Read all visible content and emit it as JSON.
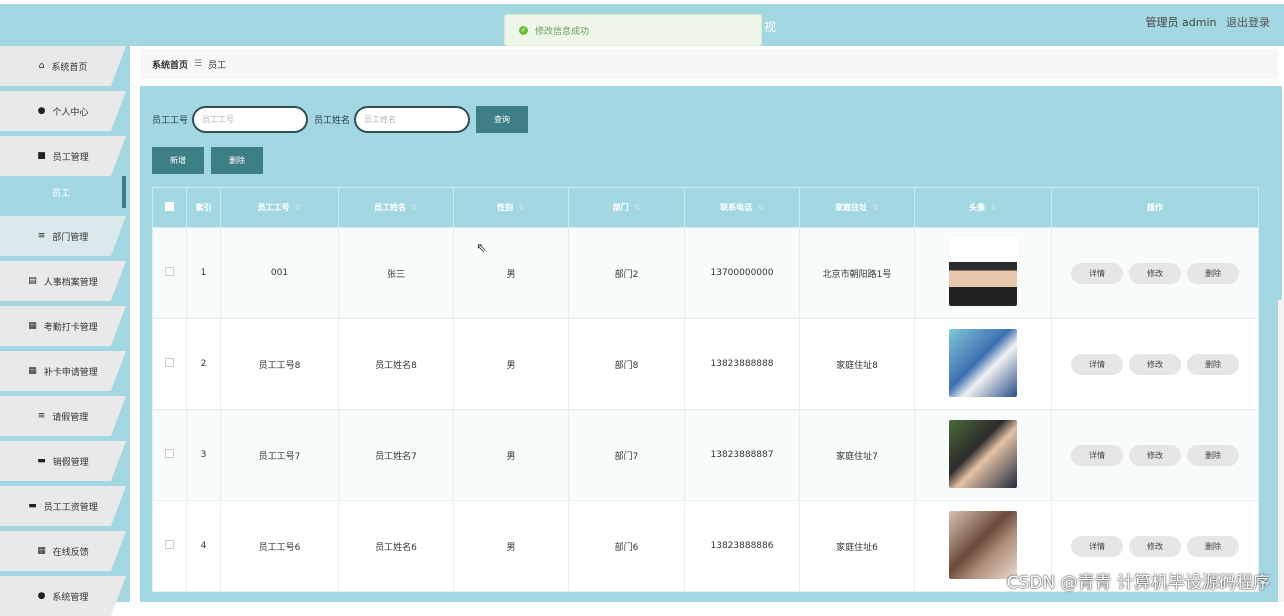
{
  "header": {
    "user_label": "管理员 admin",
    "logout_label": "退出登录",
    "glyph": "视"
  },
  "toast": {
    "message": "修改信息成功"
  },
  "sidebar": {
    "items": [
      {
        "label": "系统首页",
        "icon": "home-icon",
        "glyph": "⌂"
      },
      {
        "label": "个人中心",
        "icon": "user-icon",
        "glyph": "●"
      },
      {
        "label": "员工管理",
        "icon": "briefcase-icon",
        "glyph": "■"
      },
      {
        "label": "员工",
        "icon": "",
        "glyph": ""
      },
      {
        "label": "部门管理",
        "icon": "list-icon",
        "glyph": "≡"
      },
      {
        "label": "人事档案管理",
        "icon": "file-icon",
        "glyph": "▤"
      },
      {
        "label": "考勤打卡管理",
        "icon": "grid-icon",
        "glyph": "▦"
      },
      {
        "label": "补卡申请管理",
        "icon": "grid-icon",
        "glyph": "▦"
      },
      {
        "label": "请假管理",
        "icon": "list-icon",
        "glyph": "≡"
      },
      {
        "label": "销假管理",
        "icon": "monitor-icon",
        "glyph": "▬"
      },
      {
        "label": "员工工资管理",
        "icon": "monitor-icon",
        "glyph": "▬"
      },
      {
        "label": "在线反馈",
        "icon": "grid-icon",
        "glyph": "▦"
      },
      {
        "label": "系统管理",
        "icon": "settings-icon",
        "glyph": "●"
      }
    ]
  },
  "breadcrumb": {
    "home": "系统首页",
    "sep": "☰",
    "current": "员工"
  },
  "search": {
    "id_label": "员工工号",
    "id_placeholder": "员工工号",
    "name_label": "员工姓名",
    "name_placeholder": "员工姓名",
    "query_label": "查询"
  },
  "actions": {
    "add_label": "新增",
    "delete_label": "删除"
  },
  "table": {
    "headers": [
      "索引",
      "员工工号",
      "员工姓名",
      "性别",
      "部门",
      "联系电话",
      "家庭住址",
      "头像",
      "操作"
    ],
    "rows": [
      {
        "index": "1",
        "id": "001",
        "name": "张三",
        "gender": "男",
        "dept": "部门2",
        "phone": "13700000000",
        "address": "北京市朝阳路1号",
        "photo": "ph1"
      },
      {
        "index": "2",
        "id": "员工工号8",
        "name": "员工姓名8",
        "gender": "男",
        "dept": "部门8",
        "phone": "13823888888",
        "address": "家庭住址8",
        "photo": "ph2"
      },
      {
        "index": "3",
        "id": "员工工号7",
        "name": "员工姓名7",
        "gender": "男",
        "dept": "部门7",
        "phone": "13823888887",
        "address": "家庭住址7",
        "photo": "ph3"
      },
      {
        "index": "4",
        "id": "员工工号6",
        "name": "员工姓名6",
        "gender": "男",
        "dept": "部门6",
        "phone": "13823888886",
        "address": "家庭住址6",
        "photo": "ph4"
      }
    ],
    "row_actions": [
      "详情",
      "修改",
      "删除"
    ]
  },
  "watermark": "CSDN @青青  计算机毕设源码程序",
  "colors": {
    "accent": "#a3d8e2",
    "button": "#3e7f86",
    "success": "#67c23a"
  }
}
